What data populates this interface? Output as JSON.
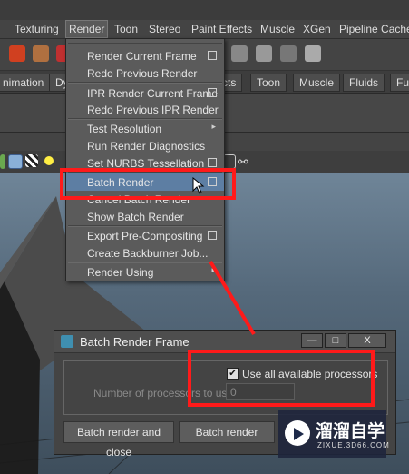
{
  "menubar": [
    "Texturing",
    "Render",
    "Toon",
    "Stereo",
    "Paint Effects",
    "Muscle",
    "XGen",
    "Pipeline Cache"
  ],
  "shelf_tabs": [
    "nimation",
    "Dy",
    "cts",
    "Toon",
    "Muscle",
    "Fluids",
    "Fu"
  ],
  "render_menu": {
    "items": [
      {
        "label": "Render Current Frame",
        "opt": true
      },
      {
        "label": "Redo Previous Render"
      },
      {
        "label": "IPR Render Current Frame",
        "opt": true
      },
      {
        "label": "Redo Previous IPR Render"
      },
      {
        "label": "Test Resolution",
        "sub": true
      },
      {
        "label": "Run Render Diagnostics"
      },
      {
        "label": "Set NURBS Tessellation",
        "opt": true
      },
      {
        "label": "Batch Render",
        "opt": true,
        "highlight": true
      },
      {
        "label": "Cancel Batch Render"
      },
      {
        "label": "Show Batch Render"
      },
      {
        "label": "Export Pre-Compositing",
        "opt": true
      },
      {
        "label": "Create Backburner Job..."
      },
      {
        "label": "Render Using",
        "sub": true
      }
    ]
  },
  "dialog": {
    "title": "Batch Render Frame",
    "checkbox_label": "Use all available processors",
    "checkbox_checked": true,
    "processors_label": "Number of processors to use",
    "processors_value": "0",
    "btn_close": "Batch render and close",
    "btn_render": "Batch render",
    "win_min": "—",
    "win_max": "□",
    "win_close": "X"
  },
  "watermark": {
    "name": "溜溜自学",
    "url": "ZIXUE.3D66.COM"
  },
  "colors": {
    "annotation": "#ff1a1a",
    "highlight": "#5d7ea3"
  }
}
